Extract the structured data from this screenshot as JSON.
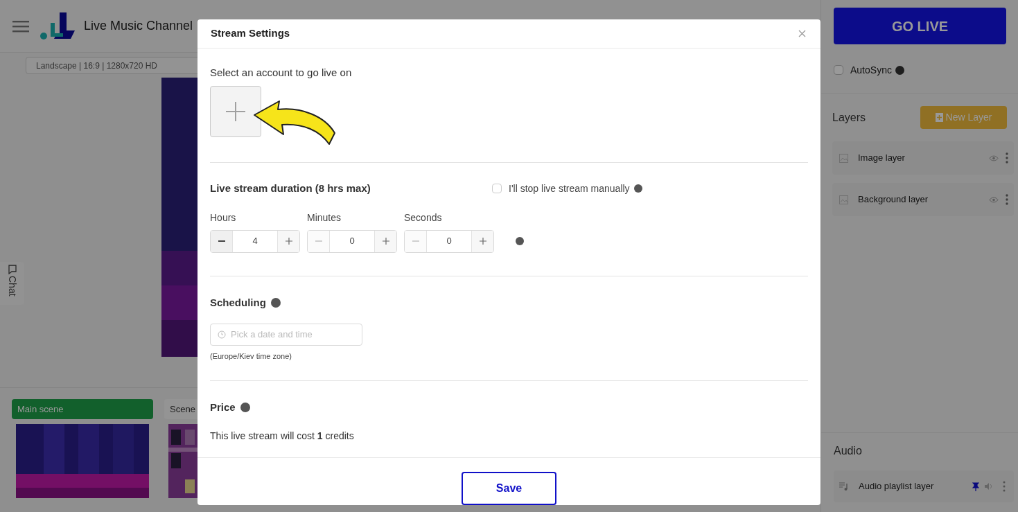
{
  "app": {
    "title": "Live Music Channel",
    "resolution": "Landscape | 16:9 | 1280x720 HD",
    "chat_tab": "Chat"
  },
  "scenes": [
    {
      "label": "Main scene",
      "selected": true
    },
    {
      "label": "Scene",
      "selected": false
    }
  ],
  "sidebar": {
    "go_live": "GO LIVE",
    "autosync": {
      "label": "AutoSync",
      "checked": false
    },
    "layers_title": "Layers",
    "new_layer": "New Layer",
    "layers": [
      {
        "name": "Image layer"
      },
      {
        "name": "Background layer"
      }
    ],
    "audio_title": "Audio",
    "audio_layers": [
      {
        "name": "Audio playlist layer",
        "pinned": true
      }
    ]
  },
  "modal": {
    "title": "Stream Settings",
    "account_prompt": "Select an account to go live on",
    "duration": {
      "title": "Live stream duration (8 hrs max)",
      "manual": {
        "label": "I'll stop live stream manually",
        "checked": false
      },
      "fields": [
        {
          "label": "Hours",
          "value": "4",
          "minus_disabled": false
        },
        {
          "label": "Minutes",
          "value": "0",
          "minus_disabled": true
        },
        {
          "label": "Seconds",
          "value": "0",
          "minus_disabled": true
        }
      ]
    },
    "scheduling": {
      "title": "Scheduling",
      "placeholder": "Pick a date and time",
      "timezone": "(Europe/Kiev time zone)"
    },
    "price": {
      "title": "Price",
      "text": "This live stream will cost **1** credits"
    },
    "save": "Save"
  }
}
